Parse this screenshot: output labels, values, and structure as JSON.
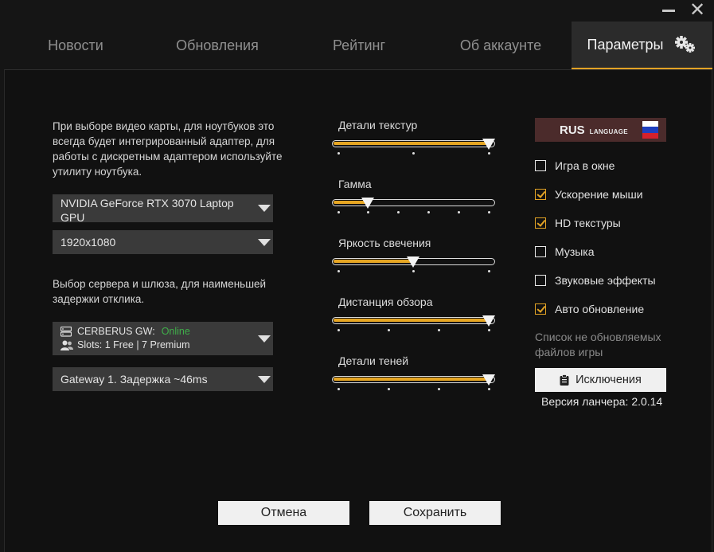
{
  "window": {
    "minimize_icon": "minimize-icon",
    "close_glyph": "✕"
  },
  "tabs": [
    {
      "label": "Новости"
    },
    {
      "label": "Обновления"
    },
    {
      "label": "Рейтинг"
    },
    {
      "label": "Об аккаунте"
    },
    {
      "label": "Параметры",
      "active": true,
      "icon": "gears-icon"
    }
  ],
  "video": {
    "description": "При выборе видео карты, для ноутбуков это всегда будет интегрированный адаптер, для работы с дискретным адаптером используйте утилиту ноутбука.",
    "gpu_value": "NVIDIA GeForce RTX 3070 Laptop GPU",
    "resolution_value": "1920x1080"
  },
  "server": {
    "description": "Выбор сервера и шлюза, для наименьшей задержки отклика.",
    "name": "CERBERUS GW:",
    "status": "Online",
    "slots": "Slots: 1 Free | 7 Premium",
    "gateway_value": "Gateway 1. Задержка ~46ms"
  },
  "sliders": [
    {
      "label": "Детали текстур",
      "value": 1.0,
      "steps": 3
    },
    {
      "label": "Гамма",
      "value": 0.2,
      "steps": 6
    },
    {
      "label": "Яркость свечения",
      "value": 0.5,
      "steps": 3
    },
    {
      "label": "Дистанция обзора",
      "value": 1.0,
      "steps": 4
    },
    {
      "label": "Детали теней",
      "value": 1.0,
      "steps": 4
    }
  ],
  "language": {
    "code": "RUS",
    "sub": "LANGUAGE",
    "flag_colors": [
      "#ffffff",
      "#1f3fbf",
      "#d3212c"
    ]
  },
  "options": [
    {
      "label": "Игра в окне",
      "checked": false
    },
    {
      "label": "Ускорение мыши",
      "checked": true
    },
    {
      "label": "HD текстуры",
      "checked": true
    },
    {
      "label": "Музыка",
      "checked": false
    },
    {
      "label": "Звуковые эффекты",
      "checked": false
    },
    {
      "label": "Авто обновление",
      "checked": true
    }
  ],
  "exclusions": {
    "note": "Список не обновляемых файлов игры",
    "button_label": "Исключения"
  },
  "version": "Версия ланчера: 2.0.14",
  "footer": {
    "cancel_label": "Отмена",
    "save_label": "Сохранить"
  },
  "colors": {
    "accent": "#e3a325",
    "online": "#3fae4a",
    "lang_bg": "#4b2b2b"
  }
}
